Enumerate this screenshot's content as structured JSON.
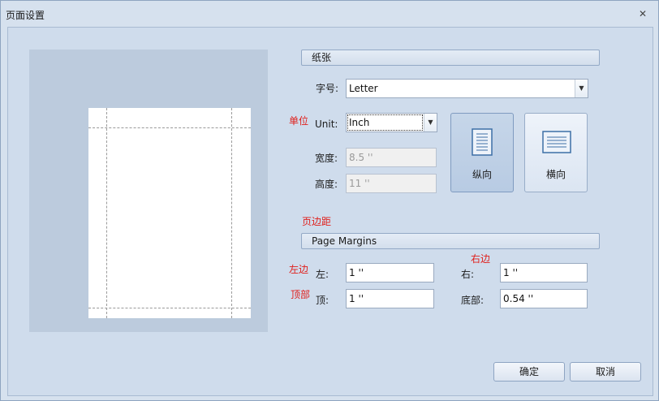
{
  "window": {
    "title": "页面设置",
    "close_glyph": "✕"
  },
  "paper_section": {
    "header": "纸张"
  },
  "size": {
    "label": "字号:",
    "value": "Letter"
  },
  "unit": {
    "label": "Unit:",
    "value": "Inch",
    "annotation": "单位"
  },
  "width": {
    "label": "宽度:",
    "value": "8.5 ''"
  },
  "height": {
    "label": "高度:",
    "value": "11 ''"
  },
  "orientation": {
    "portrait": "纵向",
    "landscape": "横向",
    "selected": "portrait"
  },
  "margins_section": {
    "header": "Page Margins",
    "annotation": "页边距"
  },
  "margins": {
    "left": {
      "label": "左:",
      "value": "1 ''",
      "annotation": "左边"
    },
    "right": {
      "label": "右:",
      "value": "1 ''",
      "annotation": "右边"
    },
    "top": {
      "label": "顶:",
      "value": "1 ''",
      "annotation": "顶部"
    },
    "bottom": {
      "label": "底部:",
      "value": "0.54 ''"
    }
  },
  "buttons": {
    "ok": "确定",
    "cancel": "取消"
  },
  "colors": {
    "annotation": "#e0201c",
    "window_bg": "#d6e1ee",
    "preview_bg": "#bccbdd"
  }
}
